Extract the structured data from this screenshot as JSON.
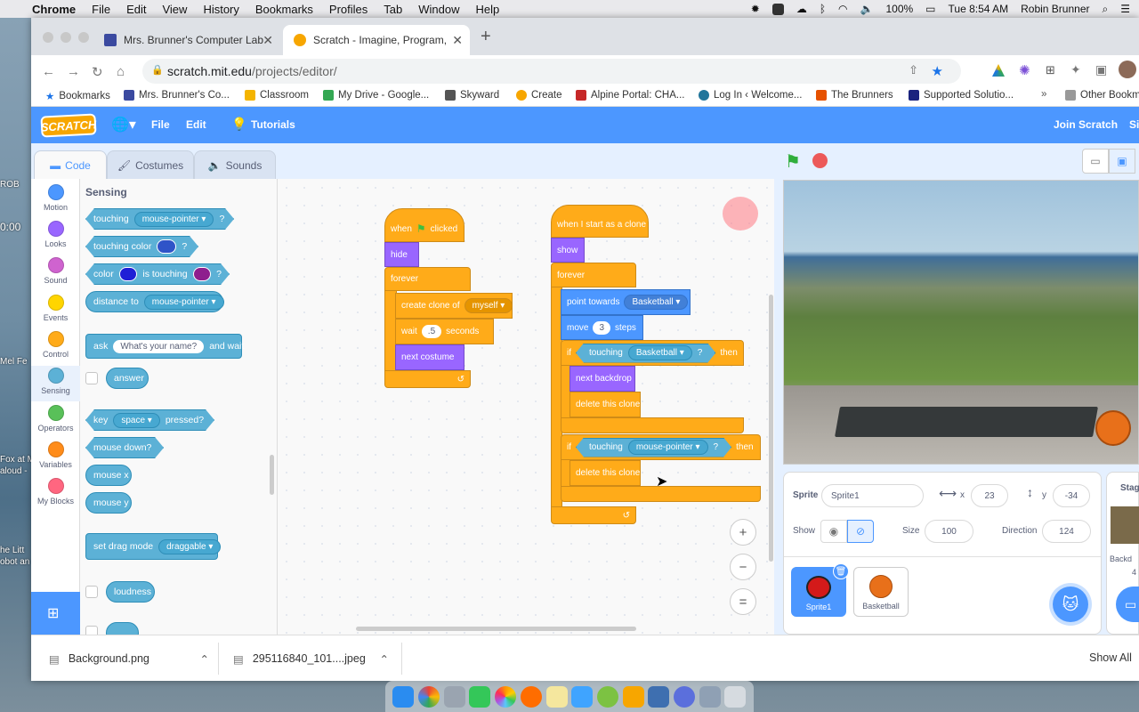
{
  "menubar": {
    "items": [
      "Chrome",
      "File",
      "Edit",
      "View",
      "History",
      "Bookmarks",
      "Profiles",
      "Tab",
      "Window",
      "Help"
    ],
    "battery": "100%",
    "clock": "Tue 8:54 AM",
    "user": "Robin Brunner"
  },
  "desktop": {
    "labels": [
      "ROB",
      "0:00",
      "Mel Fe",
      "Fox at M",
      "aloud -",
      "he Litt",
      "obot an"
    ]
  },
  "browser": {
    "tabs": [
      {
        "title": "Mrs. Brunner's Computer Lab",
        "favicon_color": "#3b4aa0"
      },
      {
        "title": "Scratch - Imagine, Program, Sh",
        "favicon_color": "#f7a600"
      }
    ],
    "new_tab": "+",
    "url_host": "scratch.mit.edu",
    "url_path": "/projects/editor/",
    "bookmarks": [
      {
        "label": "Bookmarks",
        "color": "#1a73e8"
      },
      {
        "label": "Mrs. Brunner's Co...",
        "color": "#3b4aa0"
      },
      {
        "label": "Classroom",
        "color": "#f4b400"
      },
      {
        "label": "My Drive - Google...",
        "color": "#34a853"
      },
      {
        "label": "Skyward",
        "color": "#555555"
      },
      {
        "label": "Create",
        "color": "#f7a600"
      },
      {
        "label": "Alpine Portal: CHA...",
        "color": "#c62828"
      },
      {
        "label": "Log In ‹ Welcome...",
        "color": "#21759b"
      },
      {
        "label": "The Brunners",
        "color": "#e65100"
      },
      {
        "label": "Supported Solutio...",
        "color": "#1a237e"
      },
      {
        "label": "Other Bookm",
        "color": "#666666"
      }
    ]
  },
  "scratch": {
    "logo": "SCRATCH",
    "menu": {
      "file": "File",
      "edit": "Edit",
      "tutorials": "Tutorials",
      "join": "Join Scratch",
      "sign": "Si"
    },
    "tabs": {
      "code": "Code",
      "costumes": "Costumes",
      "sounds": "Sounds"
    },
    "categories": [
      {
        "label": "Motion",
        "color": "#4c97ff"
      },
      {
        "label": "Looks",
        "color": "#9966ff"
      },
      {
        "label": "Sound",
        "color": "#cf63cf"
      },
      {
        "label": "Events",
        "color": "#ffd500"
      },
      {
        "label": "Control",
        "color": "#ffab19"
      },
      {
        "label": "Sensing",
        "color": "#5cb1d6"
      },
      {
        "label": "Operators",
        "color": "#59c059"
      },
      {
        "label": "Variables",
        "color": "#ff8c1a"
      },
      {
        "label": "My Blocks",
        "color": "#ff6680"
      }
    ],
    "palette": {
      "title": "Sensing",
      "touching": "touching",
      "touching_dd": "mouse-pointer",
      "q": "?",
      "touching_color": "touching color",
      "color": "color",
      "is_touching": "is touching",
      "distance_to": "distance to",
      "distance_dd": "mouse-pointer",
      "ask": "ask",
      "ask_input": "What's your name?",
      "and_wait": "and wait",
      "answer": "answer",
      "key": "key",
      "key_dd": "space",
      "pressed": "pressed?",
      "mouse_down": "mouse down?",
      "mouse_x": "mouse x",
      "mouse_y": "mouse y",
      "set_drag": "set drag mode",
      "drag_dd": "draggable",
      "loudness": "loudness"
    },
    "script1": {
      "when": "when",
      "clicked": "clicked",
      "hide": "hide",
      "forever": "forever",
      "create_clone": "create clone of",
      "clone_dd": "myself",
      "wait": "wait",
      "wait_val": ".5",
      "seconds": "seconds",
      "next_costume": "next costume"
    },
    "script2": {
      "hat": "when I start as a clone",
      "show": "show",
      "forever": "forever",
      "point": "point towards",
      "point_dd": "Basketball",
      "move": "move",
      "move_val": "3",
      "steps": "steps",
      "if": "if",
      "touching": "touching",
      "touch_dd1": "Basketball",
      "q": "?",
      "then": "then",
      "next_backdrop": "next backdrop",
      "delete1": "delete this clone",
      "touch_dd2": "mouse-pointer",
      "delete2": "delete this clone"
    },
    "zoom": {
      "in": "+",
      "out": "−",
      "reset": "="
    },
    "sprite_info": {
      "sprite_label": "Sprite",
      "sprite_name": "Sprite1",
      "x_label": "x",
      "x": "23",
      "y_label": "y",
      "y": "-34",
      "show_label": "Show",
      "size_label": "Size",
      "size": "100",
      "direction_label": "Direction",
      "direction": "124"
    },
    "sprites": [
      {
        "name": "Sprite1"
      },
      {
        "name": "Basketball"
      }
    ],
    "stage_pane": {
      "label": "Stag",
      "backdrops": "Backd",
      "count": "4"
    }
  },
  "downloads": {
    "items": [
      "Background.png",
      "295116840_101....jpeg"
    ],
    "show_all": "Show All"
  }
}
